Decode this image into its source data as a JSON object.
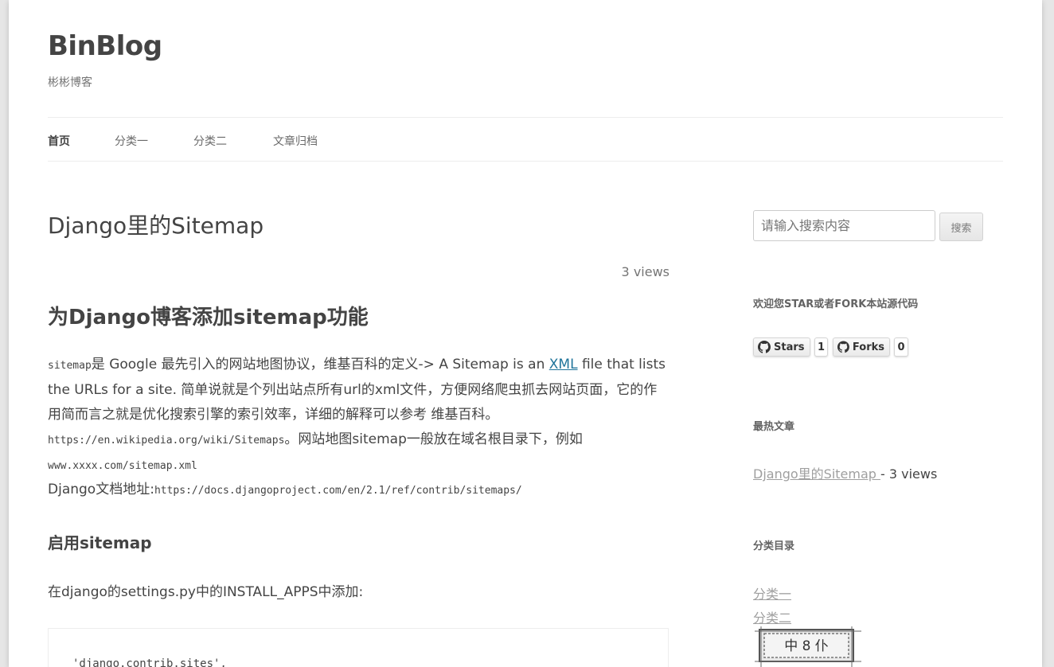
{
  "site": {
    "title": "BinBlog",
    "description": "彬彬博客"
  },
  "nav": {
    "items": [
      {
        "label": "首页",
        "current": true
      },
      {
        "label": "分类一",
        "current": false
      },
      {
        "label": "分类二",
        "current": false
      },
      {
        "label": "文章归档",
        "current": false
      }
    ]
  },
  "article": {
    "title": "Django里的Sitemap",
    "views": "3 views",
    "heading": "为Django博客添加sitemap功能",
    "p1": {
      "code1": "sitemap",
      "text1": "是 Google 最先引入的网站地图协议，维基百科的定义-> A Sitemap is an ",
      "link": "XML",
      "text2": " file that lists the URLs for a site. 简单说就是个列出站点所有url的xml文件，方便网络爬虫抓去网站页面，它的作用简而言之就是优化搜索引擎的索引效率，详细的解释可以参考 维基百科。",
      "code2": "https://en.wikipedia.org/wiki/Sitemaps",
      "text3": "。网站地图sitemap一般放在域名根目录下，例如",
      "code3": "www.xxxx.com/sitemap.xml"
    },
    "p2": {
      "text": "Django文档地址:",
      "code": "https://docs.djangoproject.com/en/2.1/ref/contrib/sitemaps/"
    },
    "subheading": "启用sitemap",
    "p3": "在django的settings.py中的INSTALL_APPS中添加:",
    "code_block": "'django.contrib.sites',"
  },
  "sidebar": {
    "search": {
      "placeholder": "请输入搜索内容",
      "button": "搜索"
    },
    "github": {
      "title": "欢迎您STAR或者FORK本站源代码",
      "stars_label": "Stars",
      "stars_count": "1",
      "forks_label": "Forks",
      "forks_count": "0"
    },
    "hot": {
      "title": "最热文章",
      "link": "Django里的Sitemap ",
      "views": "- 3 views"
    },
    "categories": {
      "title": "分类目录",
      "items": [
        "分类一",
        "分类二"
      ]
    },
    "stamp_text": "中 8 仆"
  }
}
